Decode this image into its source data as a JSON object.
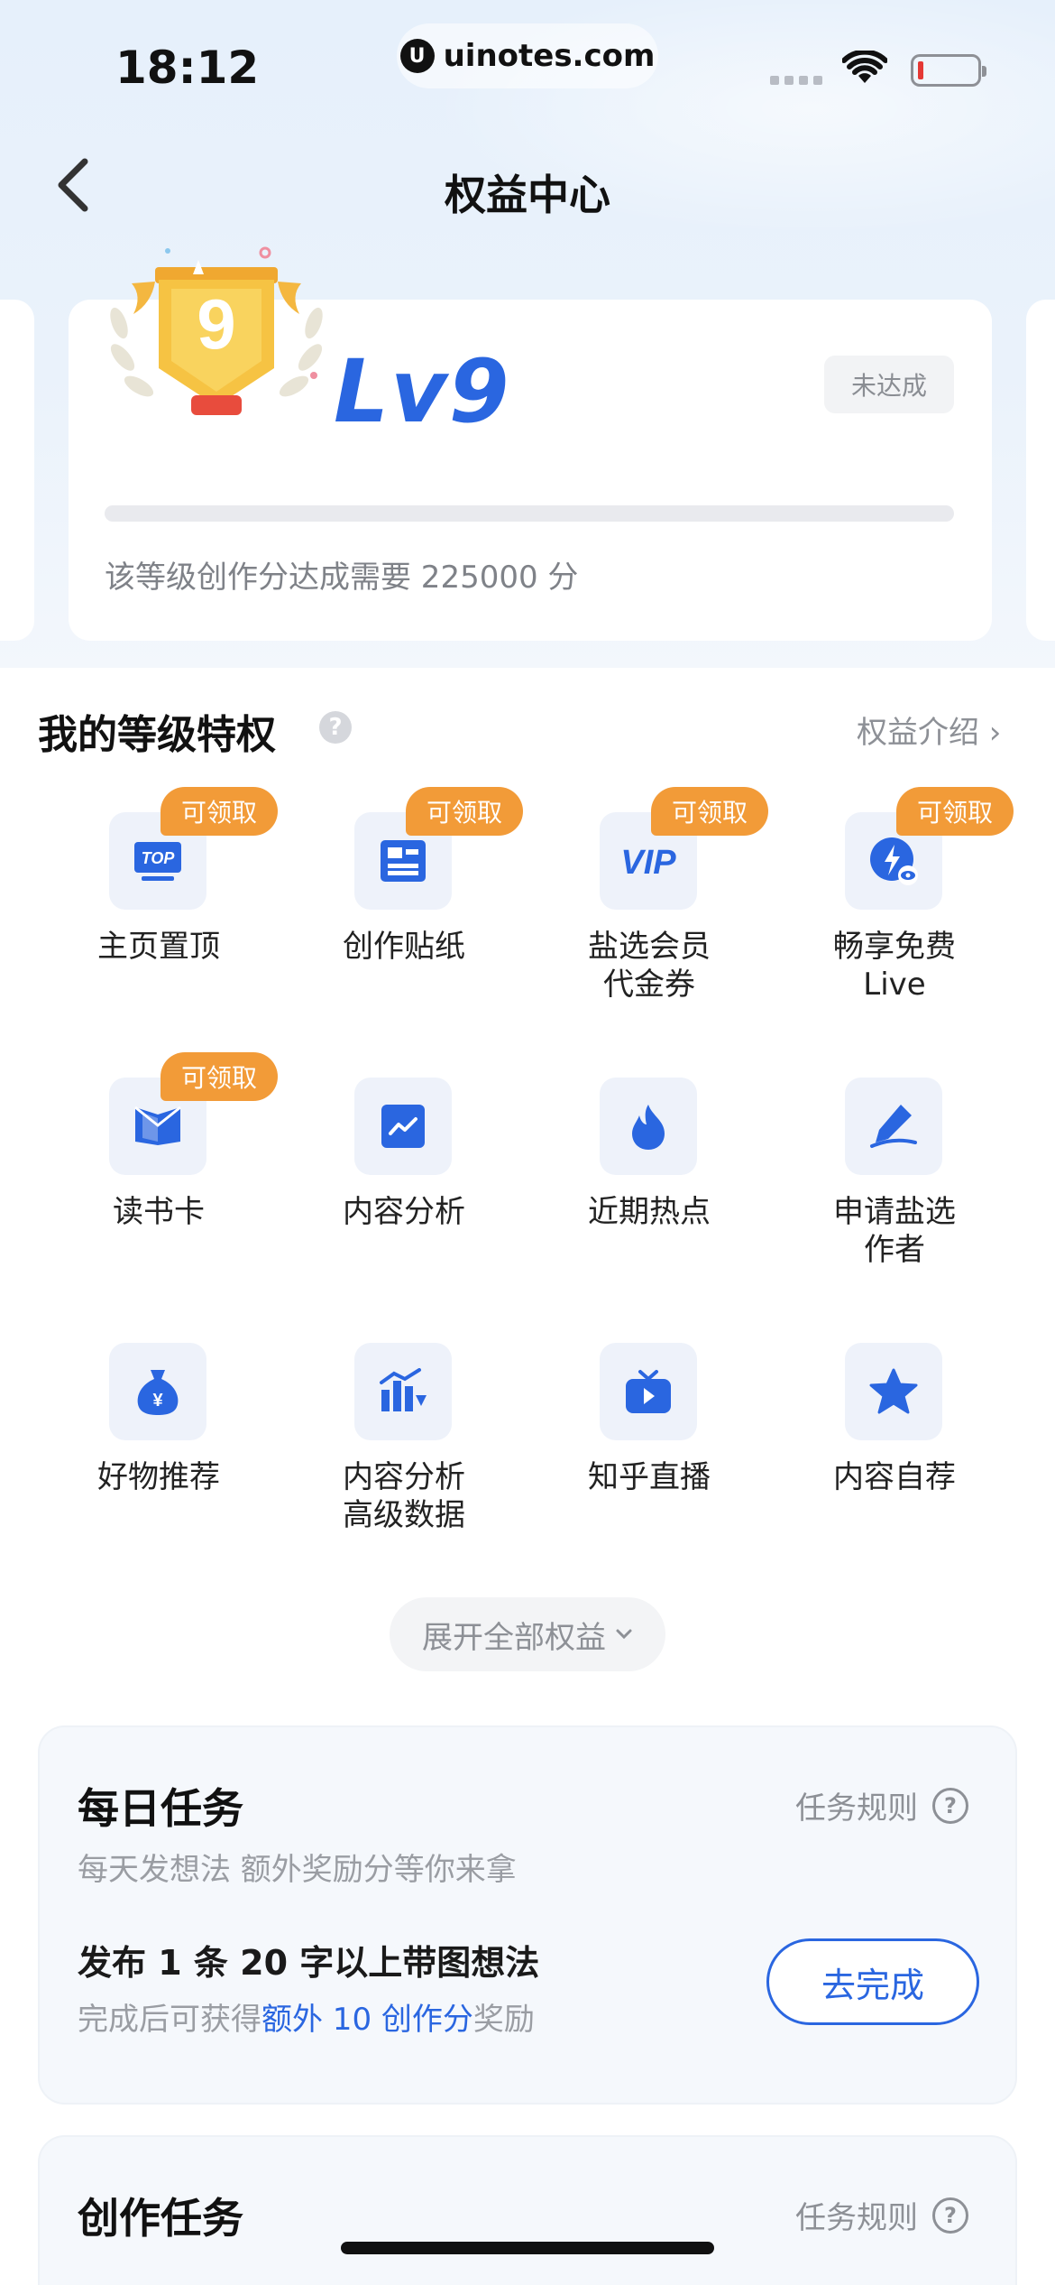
{
  "status_bar": {
    "time": "18:12",
    "url": "uinotes.com"
  },
  "header": {
    "title": "权益中心"
  },
  "level_card": {
    "medal_number": "9",
    "level": "Lv9",
    "status": "未达成",
    "progress_fraction": 0,
    "description": "该等级创作分达成需要 225000 分"
  },
  "privileges": {
    "title": "我的等级特权",
    "intro_link": "权益介绍 ›",
    "claim_label": "可领取",
    "items": [
      {
        "label": "主页置顶",
        "icon": "top-icon",
        "claimable": true
      },
      {
        "label": "创作贴纸",
        "icon": "sticker-icon",
        "claimable": true
      },
      {
        "label": "盐选会员\n代金券",
        "icon": "vip-icon",
        "claimable": true
      },
      {
        "label": "畅享免费\nLive",
        "icon": "live-icon",
        "claimable": true
      },
      {
        "label": "读书卡",
        "icon": "book-icon",
        "claimable": true
      },
      {
        "label": "内容分析",
        "icon": "chart-icon",
        "claimable": false
      },
      {
        "label": "近期热点",
        "icon": "flame-icon",
        "claimable": false
      },
      {
        "label": "申请盐选\n作者",
        "icon": "pen-icon",
        "claimable": false
      },
      {
        "label": "好物推荐",
        "icon": "money-bag-icon",
        "claimable": false
      },
      {
        "label": "内容分析\n高级数据",
        "icon": "bar-chart-icon",
        "claimable": false
      },
      {
        "label": "知乎直播",
        "icon": "tv-icon",
        "claimable": false
      },
      {
        "label": "内容自荐",
        "icon": "star-icon",
        "claimable": false
      }
    ],
    "expand_label": "展开全部权益"
  },
  "daily_task": {
    "title": "每日任务",
    "rules": "任务规则",
    "subtitle": "每天发想法 额外奖励分等你来拿",
    "item": "发布 1 条 20 字以上带图想法",
    "reward_prefix": "完成后可获得",
    "reward_highlight": "额外 10 创作分",
    "reward_suffix": "奖励",
    "button": "去完成"
  },
  "creation_task": {
    "title": "创作任务",
    "rules": "任务规则"
  },
  "colors": {
    "accent": "#2a66e0",
    "badge": "#f29b38",
    "medal": "#f6c343"
  }
}
